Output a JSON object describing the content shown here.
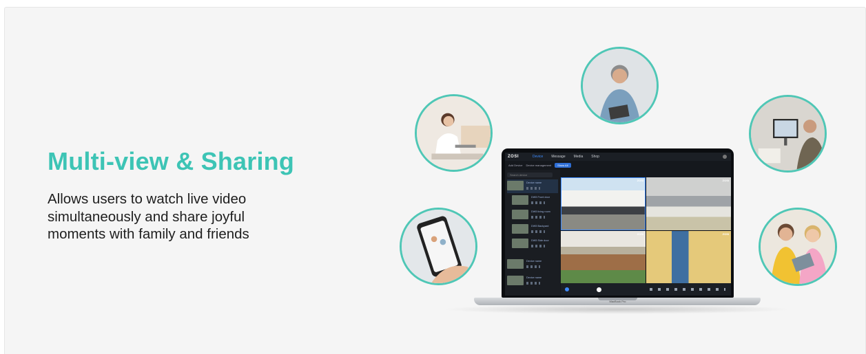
{
  "headline": "Multi-view & Sharing",
  "description": "Allows users to watch live video simultaneously and share joyful moments with family and friends",
  "accent_color": "#3dc4b5",
  "laptop": {
    "label": "MacBook Pro",
    "app": {
      "logo": "ZOSI",
      "nav": [
        "Device",
        "Message",
        "Media",
        "Shop"
      ],
      "subbar": [
        "Add Device",
        "Device management"
      ],
      "chip": "Show All",
      "search_placeholder": "Search device",
      "devices": [
        "Device name",
        "DW5 Front door",
        "DW5 living room",
        "DW5 Backyard",
        "DW5 Side door",
        "Device name",
        "Device name"
      ],
      "camera_brand": "ZOSI"
    }
  },
  "photos": [
    "woman-laptop-photo",
    "man-tablet-photo",
    "man-monitor-photo",
    "phone-app-photo",
    "kids-tablet-photo"
  ]
}
